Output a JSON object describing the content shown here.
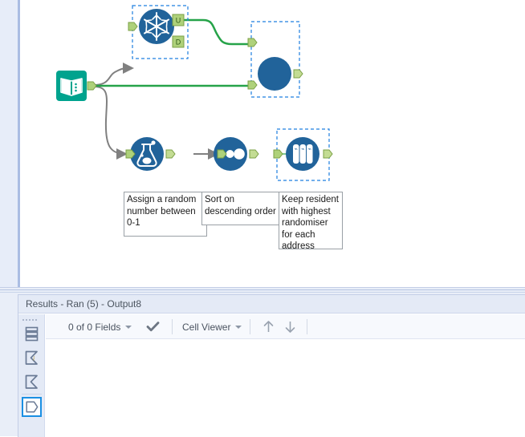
{
  "app": {
    "canvas_background": "#ffffff",
    "accent_blue": "#1a6ba8",
    "tool_blue": "#21639a",
    "tool_teal": "#00a38e",
    "anchor_green": "#aed17a",
    "connection_green": "#26a349",
    "connection_grey": "#808080",
    "selection_blue": "#1f7fe0",
    "panel_blue": "#e9eef8"
  },
  "canvas": {
    "tools": [
      {
        "id": "input-data",
        "name": "input-data-tool",
        "icon": "open-book-icon",
        "selected": false
      },
      {
        "id": "unique",
        "name": "unique-tool",
        "icon": "snowflake-icon",
        "selected": true,
        "output_anchors": [
          "U",
          "D"
        ]
      },
      {
        "id": "join",
        "name": "join-tool",
        "icon": "filled-circle-icon",
        "selected": true
      },
      {
        "id": "formula",
        "name": "formula-tool",
        "icon": "flask-icon",
        "selected": false
      },
      {
        "id": "sort",
        "name": "sort-tool",
        "icon": "three-dots-icon",
        "selected": false
      },
      {
        "id": "sample",
        "name": "sample-tool",
        "icon": "test-tubes-icon",
        "selected": true
      }
    ],
    "annotations": [
      {
        "name": "annotation-formula",
        "text": "Assign a random number between 0-1"
      },
      {
        "name": "annotation-sort",
        "text": "Sort on descending order"
      },
      {
        "name": "annotation-sample",
        "text": "Keep resident with highest randomiser for each address"
      }
    ]
  },
  "results": {
    "title": "Results - Ran (5) - Output8",
    "toolbar": {
      "fields_label": "0 of 0 Fields",
      "check_icon": "check-icon",
      "viewer_label": "Cell Viewer",
      "up_icon": "arrow-up-icon",
      "down_icon": "arrow-down-icon"
    },
    "rail_items": [
      {
        "name": "rail-item-data",
        "icon": "table-rows-icon",
        "selected": false
      },
      {
        "name": "rail-item-profile",
        "icon": "sigma-i-icon",
        "selected": false
      },
      {
        "name": "rail-item-metadata",
        "icon": "sigma-icon",
        "selected": false
      },
      {
        "name": "rail-item-output",
        "icon": "pentagon-out-icon",
        "selected": true
      }
    ]
  }
}
